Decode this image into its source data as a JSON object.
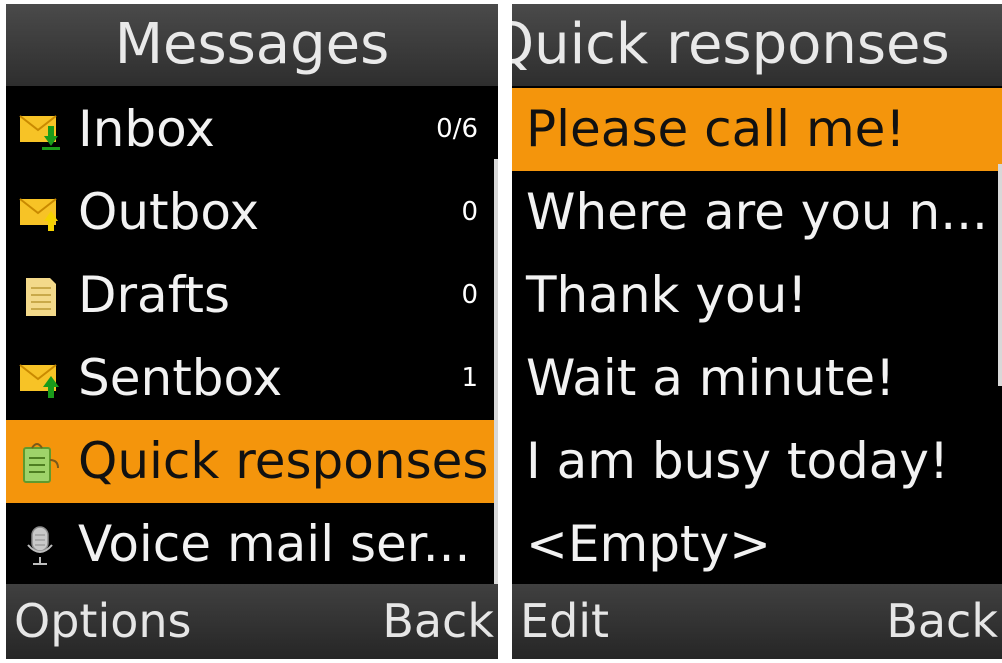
{
  "left_screen": {
    "title": "Messages",
    "items": [
      {
        "label": "Inbox",
        "count": "0/6",
        "icon": "envelope-in-icon"
      },
      {
        "label": "Outbox",
        "count": "0",
        "icon": "envelope-out-icon"
      },
      {
        "label": "Drafts",
        "count": "0",
        "icon": "draft-note-icon"
      },
      {
        "label": "Sentbox",
        "count": "1",
        "icon": "envelope-sent-icon"
      },
      {
        "label": "Quick responses",
        "count": "",
        "icon": "quick-response-icon",
        "selected": true
      },
      {
        "label": "Voice mail ser...",
        "count": "",
        "icon": "microphone-icon"
      }
    ],
    "softkeys": {
      "left": "Options",
      "right": "Back"
    }
  },
  "right_screen": {
    "title": "Quick responses",
    "items": [
      {
        "label": "Please call me!",
        "selected": true
      },
      {
        "label": "Where are you n..."
      },
      {
        "label": "Thank you!"
      },
      {
        "label": "Wait a minute!"
      },
      {
        "label": "I am busy today!"
      },
      {
        "label": "<Empty>"
      }
    ],
    "softkeys": {
      "left": "Edit",
      "right": "Back"
    }
  },
  "colors": {
    "highlight": "#f4950c",
    "background": "#000000",
    "text": "#f2f2f2"
  }
}
